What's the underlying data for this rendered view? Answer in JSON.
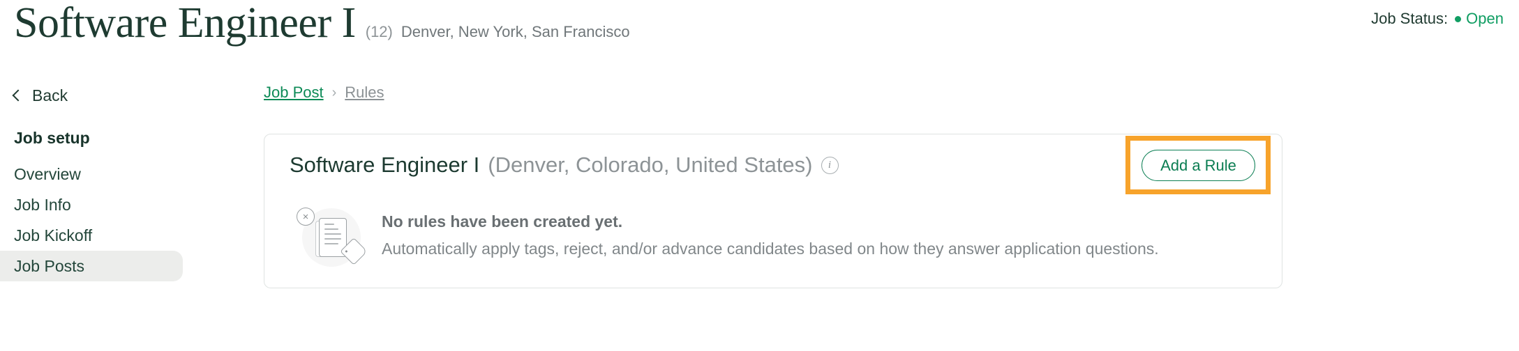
{
  "header": {
    "title": "Software Engineer I",
    "count": "(12)",
    "locations": "Denver, New York, San Francisco",
    "status_label": "Job Status:",
    "status_value": "Open",
    "status_color": "#0f9d62"
  },
  "sidebar": {
    "back_label": "Back",
    "section_label": "Job setup",
    "items": [
      {
        "label": "Overview",
        "active": false
      },
      {
        "label": "Job Info",
        "active": false
      },
      {
        "label": "Job Kickoff",
        "active": false
      },
      {
        "label": "Job Posts",
        "active": true
      }
    ]
  },
  "breadcrumb": {
    "current": "Job Post",
    "separator": "›",
    "next": "Rules"
  },
  "card": {
    "title": "Software Engineer I",
    "location": "(Denver, Colorado, United States)",
    "info_icon": "info-icon",
    "add_rule_label": "Add a Rule",
    "highlight_color": "#f7a32b",
    "empty_title": "No rules have been created yet.",
    "empty_description": "Automatically apply tags, reject, and/or advance candidates based on how they answer application questions.",
    "illustration_x": "×"
  }
}
